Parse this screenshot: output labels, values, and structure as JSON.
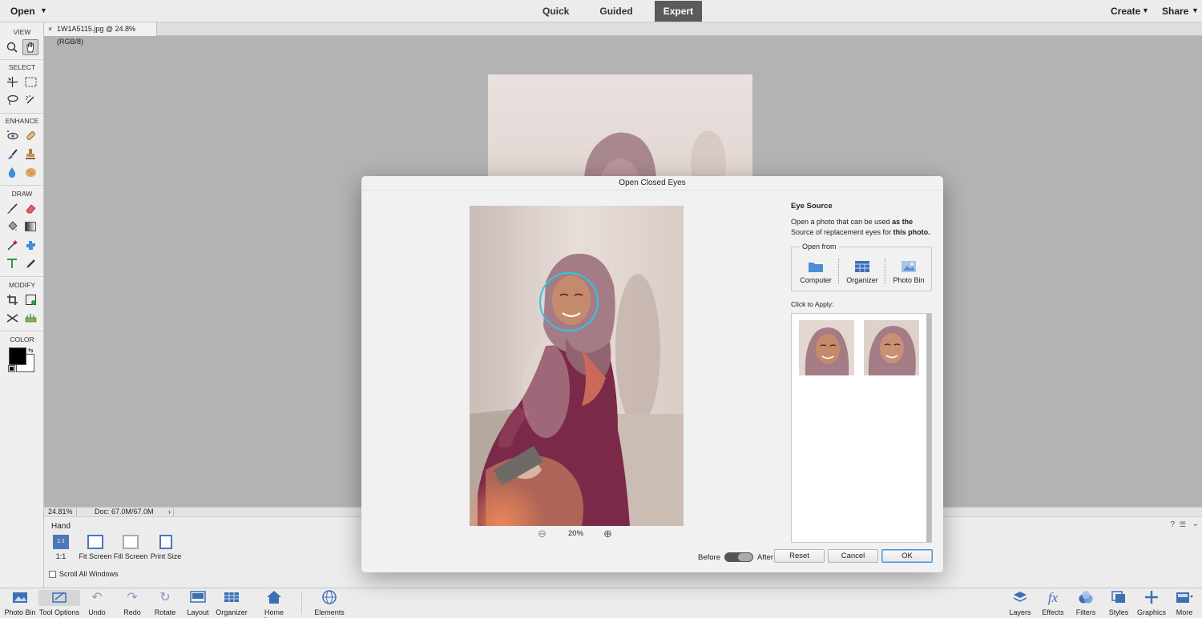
{
  "topbar": {
    "open_label": "Open",
    "modes": [
      {
        "label": "Quick",
        "active": false
      },
      {
        "label": "Guided",
        "active": false
      },
      {
        "label": "Expert",
        "active": true
      }
    ],
    "create_label": "Create",
    "share_label": "Share"
  },
  "document": {
    "tab_title": "1W1A5115.jpg @ 24.8% (RGB/8)",
    "close_glyph": "×"
  },
  "toolbox": {
    "sections": [
      "VIEW",
      "SELECT",
      "ENHANCE",
      "DRAW",
      "MODIFY",
      "COLOR"
    ],
    "foreground_color": "#000000",
    "background_color": "#ffffff"
  },
  "status": {
    "zoom": "24.81%",
    "doc_size": "Doc: 67.0M/67.0M"
  },
  "tool_options": {
    "tool_name": "Hand",
    "buttons": [
      "1:1",
      "Fit Screen",
      "Fill Screen",
      "Print Size"
    ],
    "one_to_one_icon_text": "1:1",
    "scroll_all_label": "Scroll All Windows",
    "scroll_all_checked": false
  },
  "taskbar": {
    "left": [
      "Photo Bin",
      "Tool Options",
      "Undo",
      "Redo",
      "Rotate",
      "Layout",
      "Organizer",
      "Home Screen",
      "Elements Web"
    ],
    "right": [
      "Layers",
      "Effects",
      "Filters",
      "Styles",
      "Graphics",
      "More"
    ]
  },
  "dialog": {
    "title": "Open Closed Eyes",
    "zoom_percent": "20%",
    "eye_source_title": "Eye Source",
    "eye_source_desc_1": "Open a photo that can be used ",
    "eye_source_desc_2": "as the",
    "eye_source_desc_3": " Source of replacement eyes for ",
    "eye_source_desc_4": "this photo.",
    "open_from_label": "Open from",
    "sources": [
      "Computer",
      "Organizer",
      "Photo Bin"
    ],
    "click_to_apply": "Click to Apply:",
    "before_label": "Before",
    "after_label": "After",
    "reset_label": "Reset",
    "cancel_label": "Cancel",
    "ok_label": "OK"
  },
  "colors": {
    "accent": "#3d6fb5",
    "face_circle": "#2ec7e0",
    "expert_tab": "#5b5b5b"
  }
}
